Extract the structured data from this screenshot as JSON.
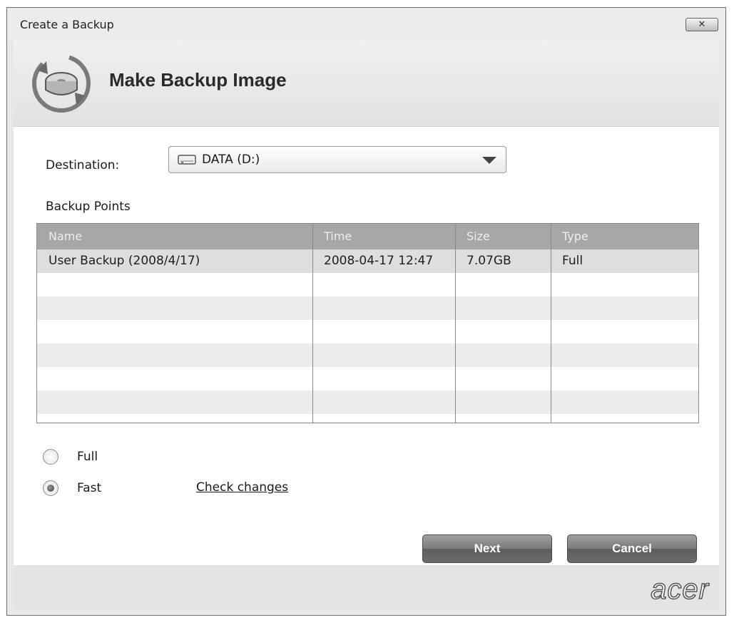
{
  "window": {
    "title": "Create a Backup",
    "close_glyph": "✕"
  },
  "header": {
    "title": "Make Backup Image",
    "icon": "backup-disk-icon"
  },
  "destination": {
    "label": "Destination:",
    "value": "DATA (D:)",
    "icon": "drive-icon"
  },
  "backup_points": {
    "label": "Backup Points",
    "columns": [
      "Name",
      "Time",
      "Size",
      "Type"
    ],
    "rows": [
      [
        "User Backup (2008/4/17)",
        "2008-04-17 12:47",
        "7.07GB",
        "Full"
      ]
    ]
  },
  "options": {
    "full_label": "Full",
    "fast_label": "Fast",
    "selected": "fast",
    "check_changes_label": "Check changes"
  },
  "buttons": {
    "next": "Next",
    "cancel": "Cancel"
  },
  "footer": {
    "brand": "acer"
  }
}
